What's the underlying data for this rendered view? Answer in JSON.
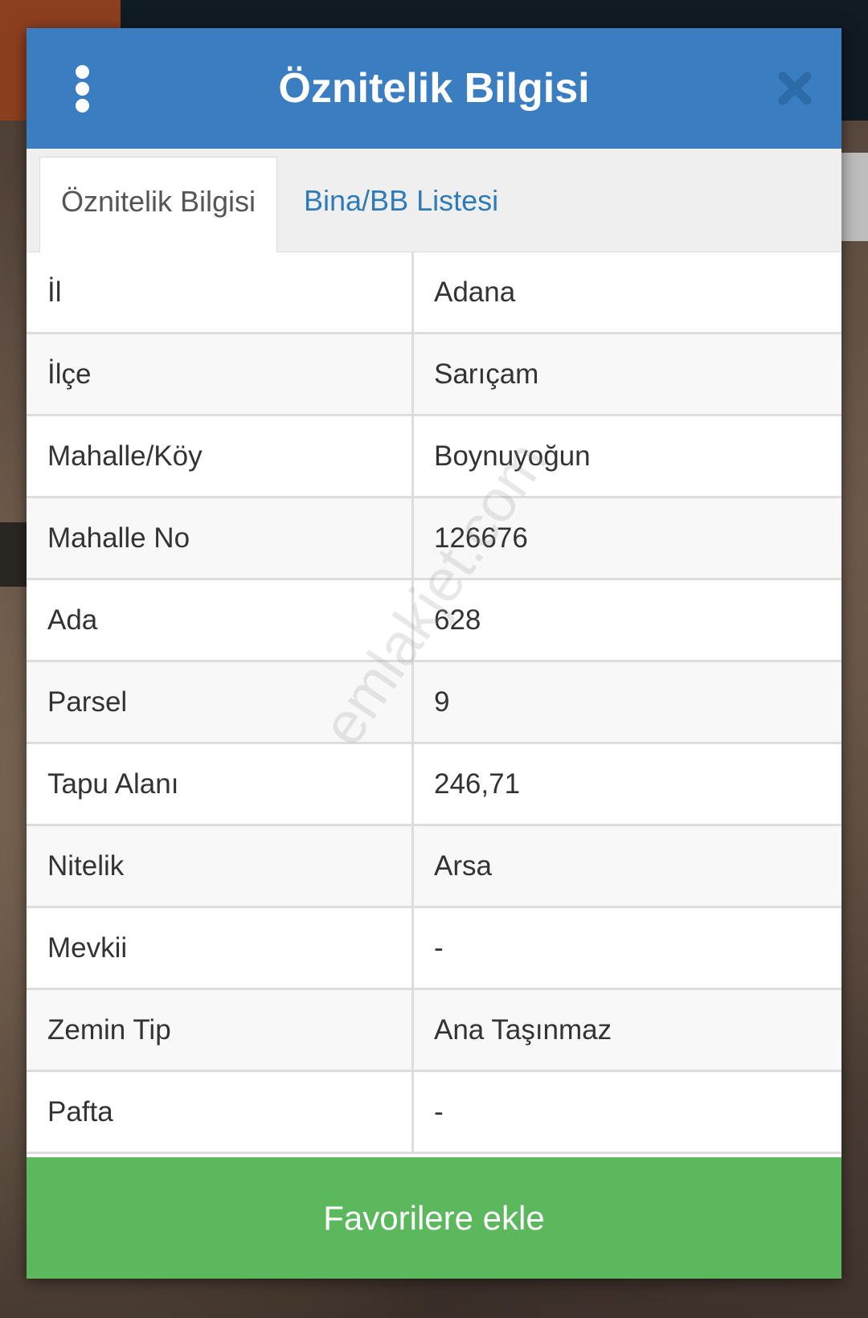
{
  "dialog": {
    "title": "Öznitelik Bilgisi",
    "menu_icon": "vertical-dots-icon",
    "close_icon": "close-icon"
  },
  "tabs": [
    {
      "label": "Öznitelik Bilgisi",
      "active": true
    },
    {
      "label": "Bina/BB Listesi",
      "active": false
    }
  ],
  "attributes": [
    {
      "key": "İl",
      "value": "Adana"
    },
    {
      "key": "İlçe",
      "value": "Sarıçam"
    },
    {
      "key": "Mahalle/Köy",
      "value": "Boynuyoğun"
    },
    {
      "key": "Mahalle No",
      "value": "126676"
    },
    {
      "key": "Ada",
      "value": "628"
    },
    {
      "key": "Parsel",
      "value": "9"
    },
    {
      "key": "Tapu Alanı",
      "value": "246,71"
    },
    {
      "key": "Nitelik",
      "value": "Arsa"
    },
    {
      "key": "Mevkii",
      "value": "-"
    },
    {
      "key": "Zemin Tip",
      "value": "Ana Taşınmaz"
    },
    {
      "key": "Pafta",
      "value": "-"
    }
  ],
  "footer": {
    "favorite_button": "Favorilere ekle"
  },
  "watermark": "emlakjet.com",
  "colors": {
    "header": "#3a7ec1",
    "tab_link": "#2f7bb8",
    "favorite_button": "#5cb85c",
    "close_icon": "#2c6aa8"
  }
}
